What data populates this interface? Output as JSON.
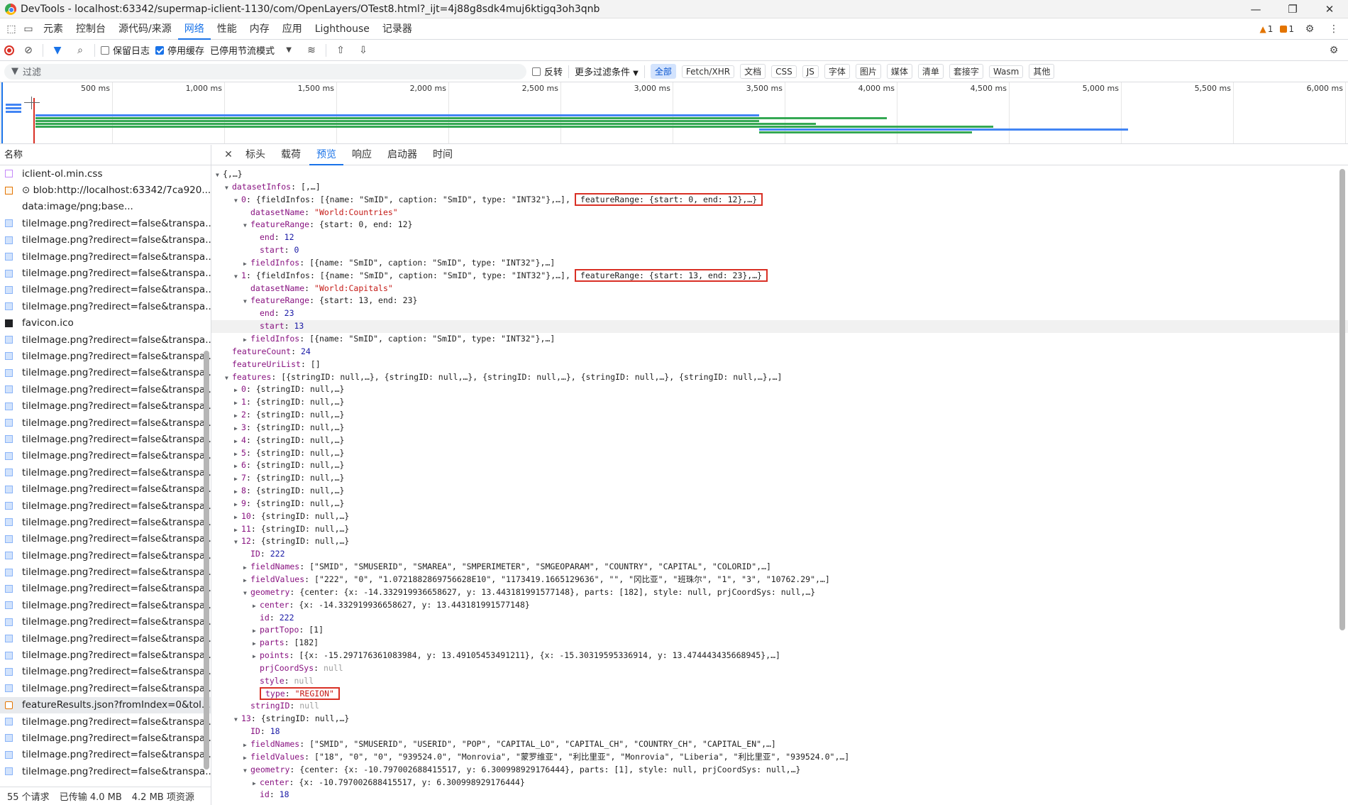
{
  "title": "DevTools - localhost:63342/supermap-iclient-1130/com/OpenLayers/OTest8.html?_ijt=4j88g8sdk4muj6ktigq3oh3qnb",
  "tabs": [
    "元素",
    "控制台",
    "源代码/来源",
    "网络",
    "性能",
    "内存",
    "应用",
    "Lighthouse",
    "记录器"
  ],
  "warnings": {
    "count1": "1",
    "count2": "1"
  },
  "toolbar": {
    "preserve_log": "保留日志",
    "disable_cache": "停用缓存",
    "throttle": "已停用节流模式"
  },
  "filter": {
    "placeholder": "过滤",
    "invert": "反转",
    "more": "更多过滤条件",
    "chips": [
      "全部",
      "Fetch/XHR",
      "文档",
      "CSS",
      "JS",
      "字体",
      "图片",
      "媒体",
      "清单",
      "套接字",
      "Wasm",
      "其他"
    ]
  },
  "timeline": {
    "ticks": [
      "500 ms",
      "1,000 ms",
      "1,500 ms",
      "2,000 ms",
      "2,500 ms",
      "3,000 ms",
      "3,500 ms",
      "4,000 ms",
      "4,500 ms",
      "5,000 ms",
      "5,500 ms",
      "6,000 ms"
    ]
  },
  "left": {
    "header": "名称",
    "rows": [
      {
        "name": "iclient-ol.min.css",
        "type": "css"
      },
      {
        "name": "⊙ blob:http://localhost:63342/7ca920...",
        "type": "blob"
      },
      {
        "name": "data:image/png;base...",
        "type": "none"
      },
      {
        "name": "tileImage.png?redirect=false&transpa...",
        "type": "img"
      },
      {
        "name": "tileImage.png?redirect=false&transpa...",
        "type": "img"
      },
      {
        "name": "tileImage.png?redirect=false&transpa...",
        "type": "img"
      },
      {
        "name": "tileImage.png?redirect=false&transpa...",
        "type": "img"
      },
      {
        "name": "tileImage.png?redirect=false&transpa...",
        "type": "img"
      },
      {
        "name": "tileImage.png?redirect=false&transpa...",
        "type": "img"
      },
      {
        "name": "favicon.ico",
        "type": "ico"
      },
      {
        "name": "tileImage.png?redirect=false&transpa...",
        "type": "img"
      },
      {
        "name": "tileImage.png?redirect=false&transpa...",
        "type": "img"
      },
      {
        "name": "tileImage.png?redirect=false&transpa...",
        "type": "img"
      },
      {
        "name": "tileImage.png?redirect=false&transpa...",
        "type": "img"
      },
      {
        "name": "tileImage.png?redirect=false&transpa...",
        "type": "img"
      },
      {
        "name": "tileImage.png?redirect=false&transpa...",
        "type": "img"
      },
      {
        "name": "tileImage.png?redirect=false&transpa...",
        "type": "img"
      },
      {
        "name": "tileImage.png?redirect=false&transpa...",
        "type": "img"
      },
      {
        "name": "tileImage.png?redirect=false&transpa...",
        "type": "img"
      },
      {
        "name": "tileImage.png?redirect=false&transpa...",
        "type": "img"
      },
      {
        "name": "tileImage.png?redirect=false&transpa...",
        "type": "img"
      },
      {
        "name": "tileImage.png?redirect=false&transpa...",
        "type": "img"
      },
      {
        "name": "tileImage.png?redirect=false&transpa...",
        "type": "img"
      },
      {
        "name": "tileImage.png?redirect=false&transpa...",
        "type": "img"
      },
      {
        "name": "tileImage.png?redirect=false&transpa...",
        "type": "img"
      },
      {
        "name": "tileImage.png?redirect=false&transpa...",
        "type": "img"
      },
      {
        "name": "tileImage.png?redirect=false&transpa...",
        "type": "img"
      },
      {
        "name": "tileImage.png?redirect=false&transpa...",
        "type": "img"
      },
      {
        "name": "tileImage.png?redirect=false&transpa...",
        "type": "img"
      },
      {
        "name": "tileImage.png?redirect=false&transpa...",
        "type": "img"
      },
      {
        "name": "tileImage.png?redirect=false&transpa...",
        "type": "img"
      },
      {
        "name": "tileImage.png?redirect=false&transpa...",
        "type": "img"
      },
      {
        "name": "featureResults.json?fromIndex=0&tol...",
        "type": "json",
        "selected": true
      },
      {
        "name": "tileImage.png?redirect=false&transpa...",
        "type": "img"
      },
      {
        "name": "tileImage.png?redirect=false&transpa...",
        "type": "img"
      },
      {
        "name": "tileImage.png?redirect=false&transpa...",
        "type": "img"
      },
      {
        "name": "tileImage.png?redirect=false&transpa...",
        "type": "img"
      }
    ],
    "footer": {
      "requests": "55 个请求",
      "transferred": "已传输 4.0 MB",
      "resources": "4.2 MB 项资源"
    }
  },
  "detail_tabs": [
    "标头",
    "载荷",
    "预览",
    "响应",
    "启动器",
    "时间"
  ],
  "tree": [
    {
      "d": 0,
      "t": "d",
      "k": "",
      "v": "{,…}",
      "vc": ""
    },
    {
      "d": 1,
      "t": "d",
      "k": "datasetInfos",
      "v": "[,…]",
      "vc": ""
    },
    {
      "d": 2,
      "t": "d",
      "k": "0",
      "v": "{fieldInfos: [{name: \"SmID\", caption: \"SmID\", type: \"INT32\"},…],",
      "vc": "",
      "box": "featureRange: {start: 0, end: 12},…}"
    },
    {
      "d": 3,
      "t": "",
      "k": "datasetName",
      "v": "\"World:Countries\"",
      "vc": "s"
    },
    {
      "d": 3,
      "t": "d",
      "k": "featureRange",
      "v": "{start: 0, end: 12}",
      "vc": ""
    },
    {
      "d": 4,
      "t": "",
      "k": "end",
      "v": "12",
      "vc": "n"
    },
    {
      "d": 4,
      "t": "",
      "k": "start",
      "v": "0",
      "vc": "n"
    },
    {
      "d": 3,
      "t": "r",
      "k": "fieldInfos",
      "v": "[{name: \"SmID\", caption: \"SmID\", type: \"INT32\"},…]",
      "vc": ""
    },
    {
      "d": 2,
      "t": "d",
      "k": "1",
      "v": "{fieldInfos: [{name: \"SmID\", caption: \"SmID\", type: \"INT32\"},…],",
      "vc": "",
      "box": "featureRange: {start: 13, end: 23},…}"
    },
    {
      "d": 3,
      "t": "",
      "k": "datasetName",
      "v": "\"World:Capitals\"",
      "vc": "s"
    },
    {
      "d": 3,
      "t": "d",
      "k": "featureRange",
      "v": "{start: 13, end: 23}",
      "vc": ""
    },
    {
      "d": 4,
      "t": "",
      "k": "end",
      "v": "23",
      "vc": "n"
    },
    {
      "d": 4,
      "t": "",
      "k": "start",
      "v": "13",
      "vc": "n",
      "hl": true
    },
    {
      "d": 3,
      "t": "r",
      "k": "fieldInfos",
      "v": "[{name: \"SmID\", caption: \"SmID\", type: \"INT32\"},…]",
      "vc": ""
    },
    {
      "d": 1,
      "t": "",
      "k": "featureCount",
      "v": "24",
      "vc": "n"
    },
    {
      "d": 1,
      "t": "",
      "k": "featureUriList",
      "v": "[]",
      "vc": ""
    },
    {
      "d": 1,
      "t": "d",
      "k": "features",
      "v": "[{stringID: null,…}, {stringID: null,…}, {stringID: null,…}, {stringID: null,…}, {stringID: null,…},…]",
      "vc": ""
    },
    {
      "d": 2,
      "t": "r",
      "k": "0",
      "v": "{stringID: null,…}",
      "vc": ""
    },
    {
      "d": 2,
      "t": "r",
      "k": "1",
      "v": "{stringID: null,…}",
      "vc": ""
    },
    {
      "d": 2,
      "t": "r",
      "k": "2",
      "v": "{stringID: null,…}",
      "vc": ""
    },
    {
      "d": 2,
      "t": "r",
      "k": "3",
      "v": "{stringID: null,…}",
      "vc": ""
    },
    {
      "d": 2,
      "t": "r",
      "k": "4",
      "v": "{stringID: null,…}",
      "vc": ""
    },
    {
      "d": 2,
      "t": "r",
      "k": "5",
      "v": "{stringID: null,…}",
      "vc": ""
    },
    {
      "d": 2,
      "t": "r",
      "k": "6",
      "v": "{stringID: null,…}",
      "vc": ""
    },
    {
      "d": 2,
      "t": "r",
      "k": "7",
      "v": "{stringID: null,…}",
      "vc": ""
    },
    {
      "d": 2,
      "t": "r",
      "k": "8",
      "v": "{stringID: null,…}",
      "vc": ""
    },
    {
      "d": 2,
      "t": "r",
      "k": "9",
      "v": "{stringID: null,…}",
      "vc": ""
    },
    {
      "d": 2,
      "t": "r",
      "k": "10",
      "v": "{stringID: null,…}",
      "vc": ""
    },
    {
      "d": 2,
      "t": "r",
      "k": "11",
      "v": "{stringID: null,…}",
      "vc": ""
    },
    {
      "d": 2,
      "t": "d",
      "k": "12",
      "v": "{stringID: null,…}",
      "vc": ""
    },
    {
      "d": 3,
      "t": "",
      "k": "ID",
      "v": "222",
      "vc": "n"
    },
    {
      "d": 3,
      "t": "r",
      "k": "fieldNames",
      "v": "[\"SMID\", \"SMUSERID\", \"SMAREA\", \"SMPERIMETER\", \"SMGEOPARAM\", \"COUNTRY\", \"CAPITAL\", \"COLORID\",…]",
      "vc": ""
    },
    {
      "d": 3,
      "t": "r",
      "k": "fieldValues",
      "v": "[\"222\", \"0\", \"1.0721882869756628E10\", \"1173419.1665129636\", \"\", \"冈比亚\", \"班珠尔\", \"1\", \"3\", \"10762.29\",…]",
      "vc": ""
    },
    {
      "d": 3,
      "t": "d",
      "k": "geometry",
      "v": "{center: {x: -14.332919936658627, y: 13.443181991577148}, parts: [182], style: null, prjCoordSys: null,…}",
      "vc": ""
    },
    {
      "d": 4,
      "t": "r",
      "k": "center",
      "v": "{x: -14.332919936658627, y: 13.443181991577148}",
      "vc": ""
    },
    {
      "d": 4,
      "t": "",
      "k": "id",
      "v": "222",
      "vc": "n"
    },
    {
      "d": 4,
      "t": "r",
      "k": "partTopo",
      "v": "[1]",
      "vc": ""
    },
    {
      "d": 4,
      "t": "r",
      "k": "parts",
      "v": "[182]",
      "vc": ""
    },
    {
      "d": 4,
      "t": "r",
      "k": "points",
      "v": "[{x: -15.297176361083984, y: 13.49105453491211}, {x: -15.30319595336914, y: 13.474443435668945},…]",
      "vc": ""
    },
    {
      "d": 4,
      "t": "",
      "k": "prjCoordSys",
      "v": "null",
      "vc": "nul"
    },
    {
      "d": 4,
      "t": "",
      "k": "style",
      "v": "null",
      "vc": "nul"
    },
    {
      "d": 4,
      "t": "",
      "k": "type",
      "v": "\"REGION\"",
      "vc": "s",
      "boxall": true
    },
    {
      "d": 3,
      "t": "",
      "k": "stringID",
      "v": "null",
      "vc": "nul"
    },
    {
      "d": 2,
      "t": "d",
      "k": "13",
      "v": "{stringID: null,…}",
      "vc": ""
    },
    {
      "d": 3,
      "t": "",
      "k": "ID",
      "v": "18",
      "vc": "n"
    },
    {
      "d": 3,
      "t": "r",
      "k": "fieldNames",
      "v": "[\"SMID\", \"SMUSERID\", \"USERID\", \"POP\", \"CAPITAL_LO\", \"CAPITAL_CH\", \"COUNTRY_CH\", \"CAPITAL_EN\",…]",
      "vc": ""
    },
    {
      "d": 3,
      "t": "r",
      "k": "fieldValues",
      "v": "[\"18\", \"0\", \"0\", \"939524.0\", \"Monrovia\", \"蒙罗维亚\", \"利比里亚\", \"Monrovia\", \"Liberia\", \"利比里亚\", \"939524.0\",…]",
      "vc": ""
    },
    {
      "d": 3,
      "t": "d",
      "k": "geometry",
      "v": "{center: {x: -10.797002688415517, y: 6.300998929176444}, parts: [1], style: null, prjCoordSys: null,…}",
      "vc": ""
    },
    {
      "d": 4,
      "t": "r",
      "k": "center",
      "v": "{x: -10.797002688415517, y: 6.300998929176444}",
      "vc": ""
    },
    {
      "d": 4,
      "t": "",
      "k": "id",
      "v": "18",
      "vc": "n"
    }
  ]
}
